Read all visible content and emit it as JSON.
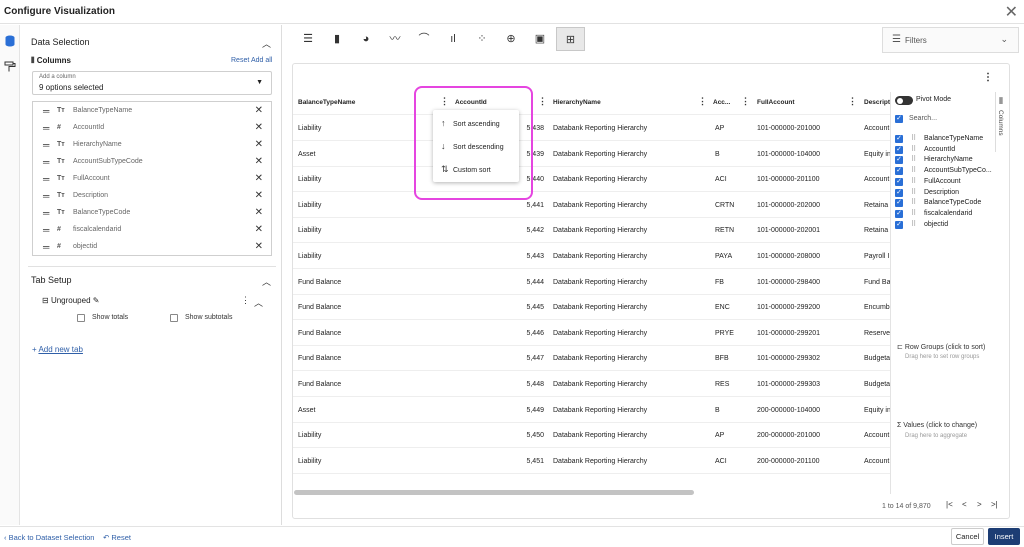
{
  "window": {
    "title": "Configure Visualization",
    "close": "✕"
  },
  "left": {
    "data_selection": "Data Selection",
    "columns_label": "Columns",
    "reset": "Reset",
    "add_all": "Add all",
    "add_column_label": "Add a column",
    "add_column_value": "9 options selected",
    "columns": [
      {
        "type": "Tт",
        "name": "BalanceTypeName"
      },
      {
        "type": "#",
        "name": "AccountId"
      },
      {
        "type": "Tт",
        "name": "HierarchyName"
      },
      {
        "type": "Tт",
        "name": "AccountSubTypeCode"
      },
      {
        "type": "Tт",
        "name": "FullAccount"
      },
      {
        "type": "Tт",
        "name": "Description"
      },
      {
        "type": "Tт",
        "name": "BalanceTypeCode"
      },
      {
        "type": "#",
        "name": "fiscalcalendarid"
      },
      {
        "type": "#",
        "name": "objectid"
      }
    ],
    "tab_setup": "Tab Setup",
    "ungrouped": "Ungrouped",
    "show_totals": "Show totals",
    "show_subtotals": "Show subtotals",
    "add_new_tab": "Add new tab"
  },
  "filters": {
    "label": "Filters"
  },
  "grid": {
    "headers": [
      "BalanceTypeName",
      "AccountId",
      "HierarchyName",
      "Acc...",
      "FullAccount",
      "Descript"
    ],
    "rows": [
      [
        "Liability",
        "5,438",
        "Databank Reporting Hierarchy",
        "AP",
        "101-000000-201000",
        "Account"
      ],
      [
        "Asset",
        "5,439",
        "Databank Reporting Hierarchy",
        "B",
        "101-000000-104000",
        "Equity in"
      ],
      [
        "Liability",
        "5,440",
        "Databank Reporting Hierarchy",
        "ACI",
        "101-000000-201100",
        "Account"
      ],
      [
        "Liability",
        "5,441",
        "Databank Reporting Hierarchy",
        "CRTN",
        "101-000000-202000",
        "Retaina"
      ],
      [
        "Liability",
        "5,442",
        "Databank Reporting Hierarchy",
        "RETN",
        "101-000000-202001",
        "Retaina"
      ],
      [
        "Liability",
        "5,443",
        "Databank Reporting Hierarchy",
        "PAYA",
        "101-000000-208000",
        "Payroll I"
      ],
      [
        "Fund Balance",
        "5,444",
        "Databank Reporting Hierarchy",
        "FB",
        "101-000000-298400",
        "Fund Ba"
      ],
      [
        "Fund Balance",
        "5,445",
        "Databank Reporting Hierarchy",
        "ENC",
        "101-000000-299200",
        "Encumb"
      ],
      [
        "Fund Balance",
        "5,446",
        "Databank Reporting Hierarchy",
        "PRYE",
        "101-000000-299201",
        "Reserve"
      ],
      [
        "Fund Balance",
        "5,447",
        "Databank Reporting Hierarchy",
        "BFB",
        "101-000000-299302",
        "Budgeta"
      ],
      [
        "Fund Balance",
        "5,448",
        "Databank Reporting Hierarchy",
        "RES",
        "101-000000-299303",
        "Budgeta"
      ],
      [
        "Asset",
        "5,449",
        "Databank Reporting Hierarchy",
        "B",
        "200-000000-104000",
        "Equity in"
      ],
      [
        "Liability",
        "5,450",
        "Databank Reporting Hierarchy",
        "AP",
        "200-000000-201000",
        "Account"
      ],
      [
        "Liability",
        "5,451",
        "Databank Reporting Hierarchy",
        "ACI",
        "200-000000-201100",
        "Account"
      ]
    ],
    "pager": "1 to 14 of 9,870"
  },
  "menu": {
    "sort_asc": "Sort ascending",
    "sort_desc": "Sort descending",
    "custom_sort": "Custom sort"
  },
  "pivot": {
    "pivot_mode": "Pivot Mode",
    "search": "Search...",
    "columns": [
      "BalanceTypeName",
      "AccountId",
      "HierarchyName",
      "AccountSubTypeCo...",
      "FullAccount",
      "Description",
      "BalanceTypeCode",
      "fiscalcalendarid",
      "objectid"
    ],
    "row_groups": "Row Groups (click to sort)",
    "row_groups_hint": "Drag here to set row groups",
    "values": "Values (click to change)",
    "values_hint": "Drag here to aggregate",
    "tab_label": "Columns"
  },
  "footer": {
    "back": "Back to Dataset Selection",
    "reset": "Reset",
    "cancel": "Cancel",
    "insert": "Insert"
  }
}
